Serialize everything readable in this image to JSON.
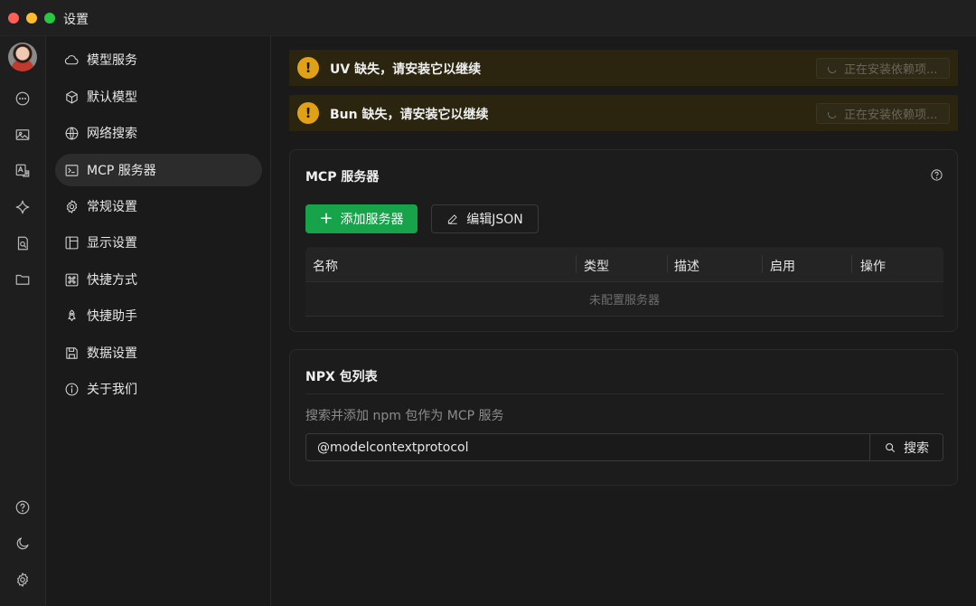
{
  "window": {
    "title": "设置"
  },
  "sidebar": {
    "items": [
      {
        "label": "模型服务",
        "icon": "cloud-icon"
      },
      {
        "label": "默认模型",
        "icon": "cube-icon"
      },
      {
        "label": "网络搜索",
        "icon": "globe-icon"
      },
      {
        "label": "MCP 服务器",
        "icon": "terminal-icon"
      },
      {
        "label": "常规设置",
        "icon": "gear-icon"
      },
      {
        "label": "显示设置",
        "icon": "layout-icon"
      },
      {
        "label": "快捷方式",
        "icon": "command-icon"
      },
      {
        "label": "快捷助手",
        "icon": "rocket-icon"
      },
      {
        "label": "数据设置",
        "icon": "save-icon"
      },
      {
        "label": "关于我们",
        "icon": "info-icon"
      }
    ]
  },
  "warnings": [
    {
      "text": "UV 缺失，请安装它以继续",
      "button": "正在安装依赖项..."
    },
    {
      "text": "Bun 缺失，请安装它以继续",
      "button": "正在安装依赖项..."
    }
  ],
  "mcp": {
    "title": "MCP 服务器",
    "add_button": "添加服务器",
    "edit_button": "编辑JSON",
    "columns": [
      "名称",
      "类型",
      "描述",
      "启用",
      "操作"
    ],
    "empty_text": "未配置服务器"
  },
  "npx": {
    "title": "NPX 包列表",
    "description": "搜索并添加 npm 包作为 MCP 服务",
    "search_value": "@modelcontextprotocol",
    "search_button": "搜索"
  }
}
